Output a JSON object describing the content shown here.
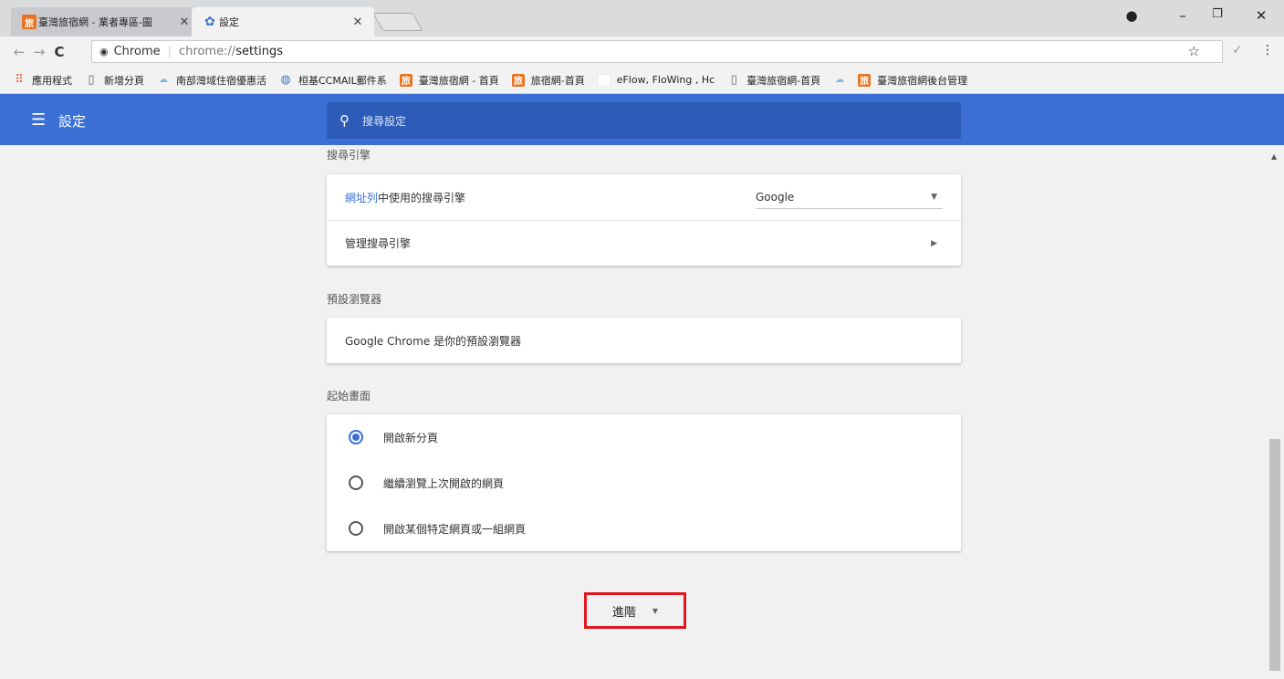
{
  "tabs": [
    {
      "title": "臺灣旅宿網 - 業者專區-圖",
      "favicon": "旅",
      "active": false
    },
    {
      "title": "設定",
      "favicon": "gear-icon",
      "active": true
    }
  ],
  "omnibox": {
    "chip": "Chrome",
    "url_scheme": "chrome://",
    "url_path": "settings"
  },
  "bookmarks": [
    {
      "label": "應用程式",
      "icon": "apps-grid-icon"
    },
    {
      "label": "新增分頁",
      "icon": "page-icon"
    },
    {
      "label": "南部灣域住宿優惠活",
      "icon": "cloud-icon"
    },
    {
      "label": "桓基CCMAIL郵件系",
      "icon": "globe-icon"
    },
    {
      "label": "臺灣旅宿網 - 首頁",
      "icon": "旅"
    },
    {
      "label": "旅宿網-首頁",
      "icon": "旅"
    },
    {
      "label": "eFlow, FloWing , Hc",
      "icon": "blank-icon"
    },
    {
      "label": "臺灣旅宿網-首頁",
      "icon": "page-icon"
    },
    {
      "label": "",
      "icon": "cloud-icon"
    },
    {
      "label": "臺灣旅宿網後台管理",
      "icon": "旅"
    }
  ],
  "header": {
    "title": "設定",
    "search_placeholder": "搜尋設定"
  },
  "search_engine": {
    "section_title": "搜尋引擎",
    "row1_link": "網址列",
    "row1_text": "中使用的搜尋引擎",
    "selected": "Google",
    "row2_label": "管理搜尋引擎"
  },
  "default_browser": {
    "section_title": "預設瀏覽器",
    "text": "Google Chrome 是你的預設瀏覽器"
  },
  "startup": {
    "section_title": "起始畫面",
    "options": [
      {
        "label": "開啟新分頁",
        "selected": true
      },
      {
        "label": "繼續瀏覽上次開啟的網頁",
        "selected": false
      },
      {
        "label": "開啟某個特定網頁或一組網頁",
        "selected": false
      }
    ]
  },
  "advanced_label": "進階",
  "colors": {
    "header_blue": "#3b6fd6",
    "highlight_red": "#e0161e"
  }
}
